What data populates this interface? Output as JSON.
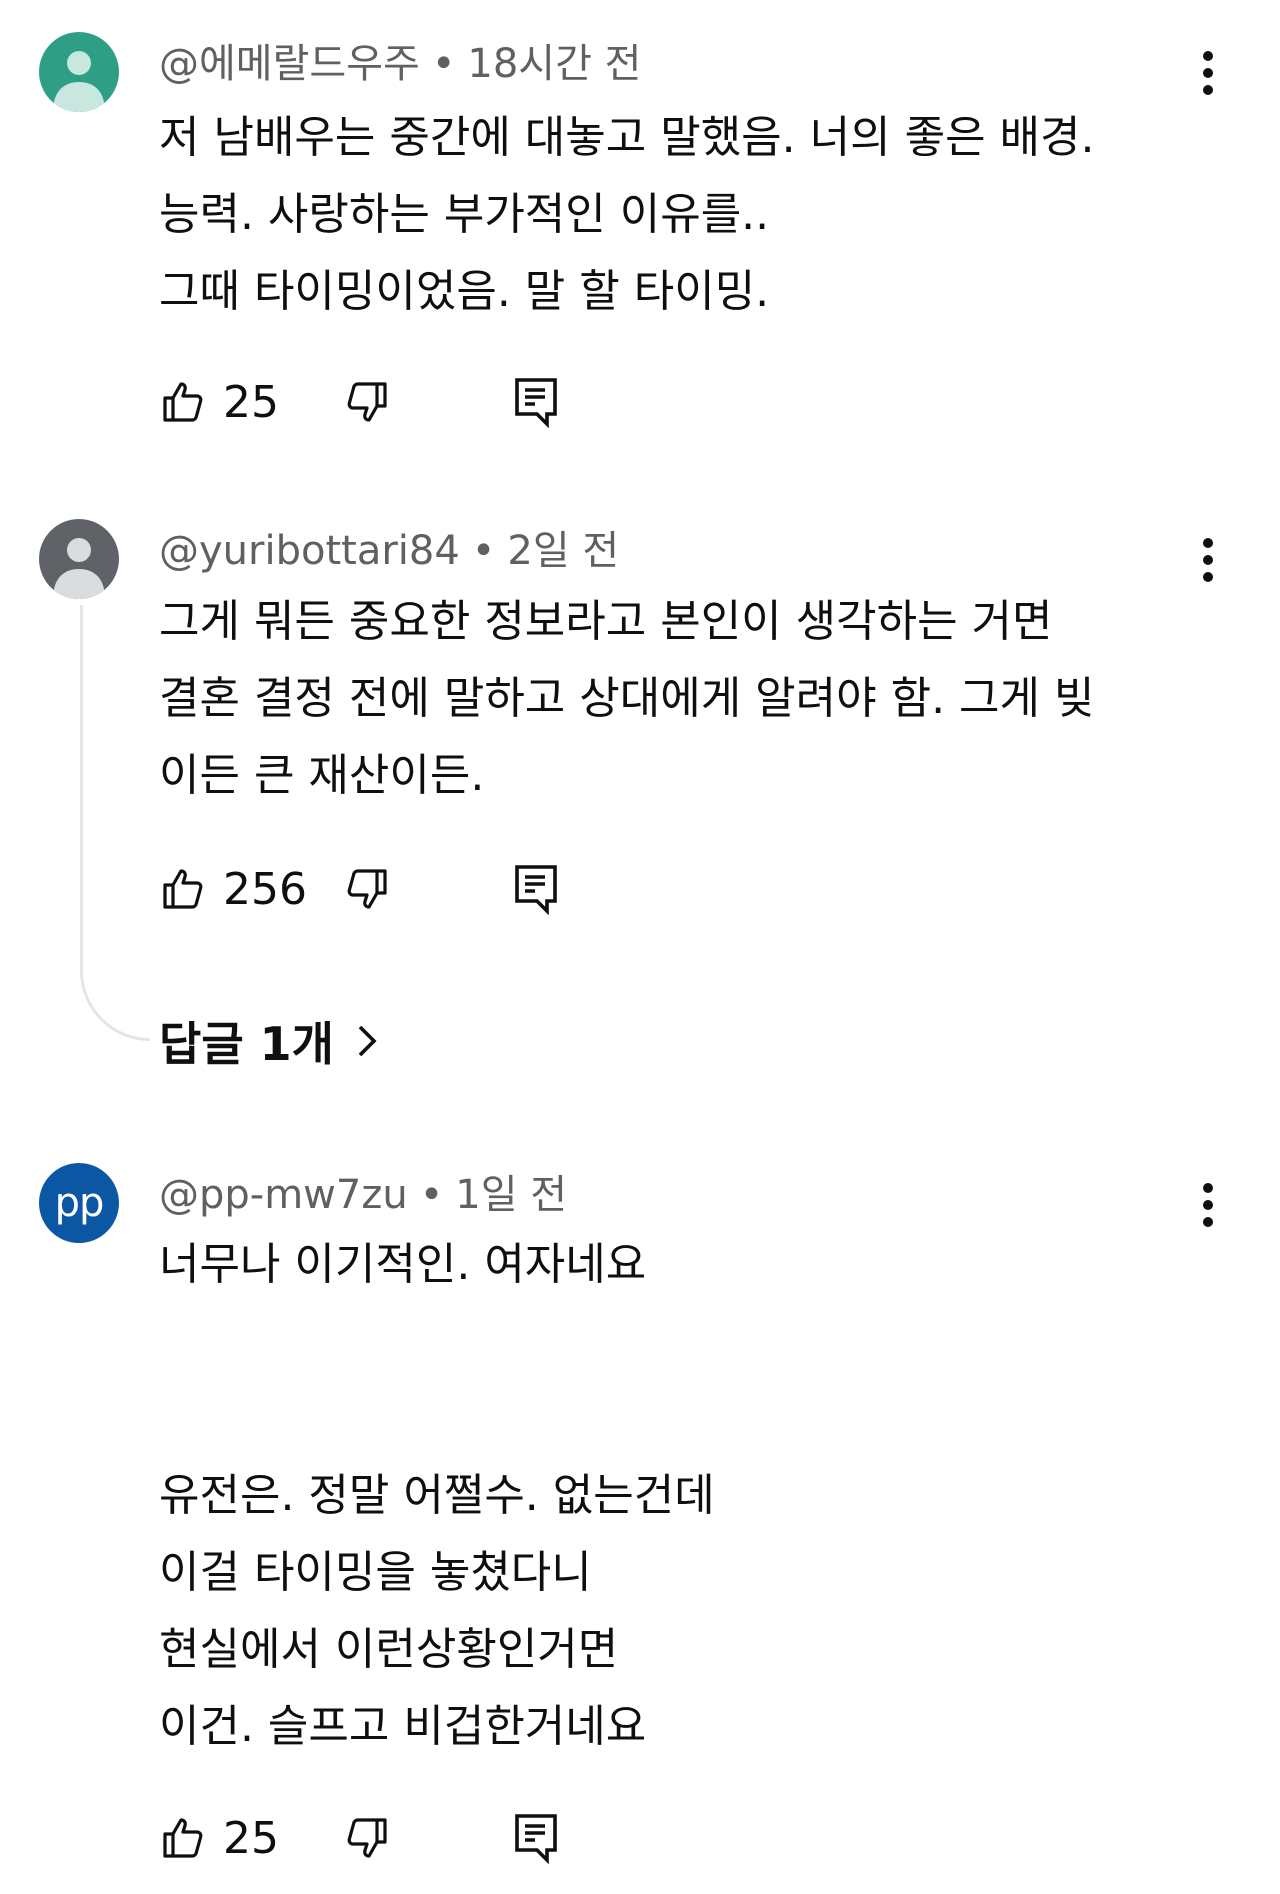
{
  "comments": [
    {
      "author": "@에메랄드우주",
      "time": "18시간 전",
      "avatar_color": "#2e9f84",
      "avatar_icon": "person-icon",
      "text": "저 남배우는 중간에 대놓고 말했음. 너의 좋은 배경.\n능력. 사랑하는 부가적인 이유를..\n그때 타이밍이었음. 말 할 타이밍.",
      "likes": "25"
    },
    {
      "author": "@yuribottari84",
      "time": "2일 전",
      "avatar_color": "#5f6368",
      "avatar_icon": "person-icon",
      "text": "그게 뭐든 중요한 정보라고 본인이 생각하는 거면\n결혼 결정 전에 말하고 상대에게 알려야 함. 그게 빚\n이든 큰 재산이든.",
      "likes": "256",
      "replies_label": "답글 1개"
    },
    {
      "author": "@pp-mw7zu",
      "time": "1일 전",
      "avatar_text": "pp",
      "avatar_color": "#0b57a4",
      "text": "너무나 이기적인. 여자네요\n\n\n유전은. 정말 어쩔수. 없는건데\n이걸 타이밍을 놓쳤다니\n현실에서 이런상황인거면\n이건. 슬프고 비겁한거네요",
      "likes": "25"
    }
  ],
  "meta_separator": "•",
  "icons": {
    "like": "thumbs-up-icon",
    "dislike": "thumbs-down-icon",
    "reply": "reply-icon",
    "more": "more-vert-icon",
    "chevron": "chevron-right-icon"
  },
  "colors": {
    "text": "#0f0f0f",
    "secondary": "#606060",
    "thread_line": "#e5e5e5"
  }
}
